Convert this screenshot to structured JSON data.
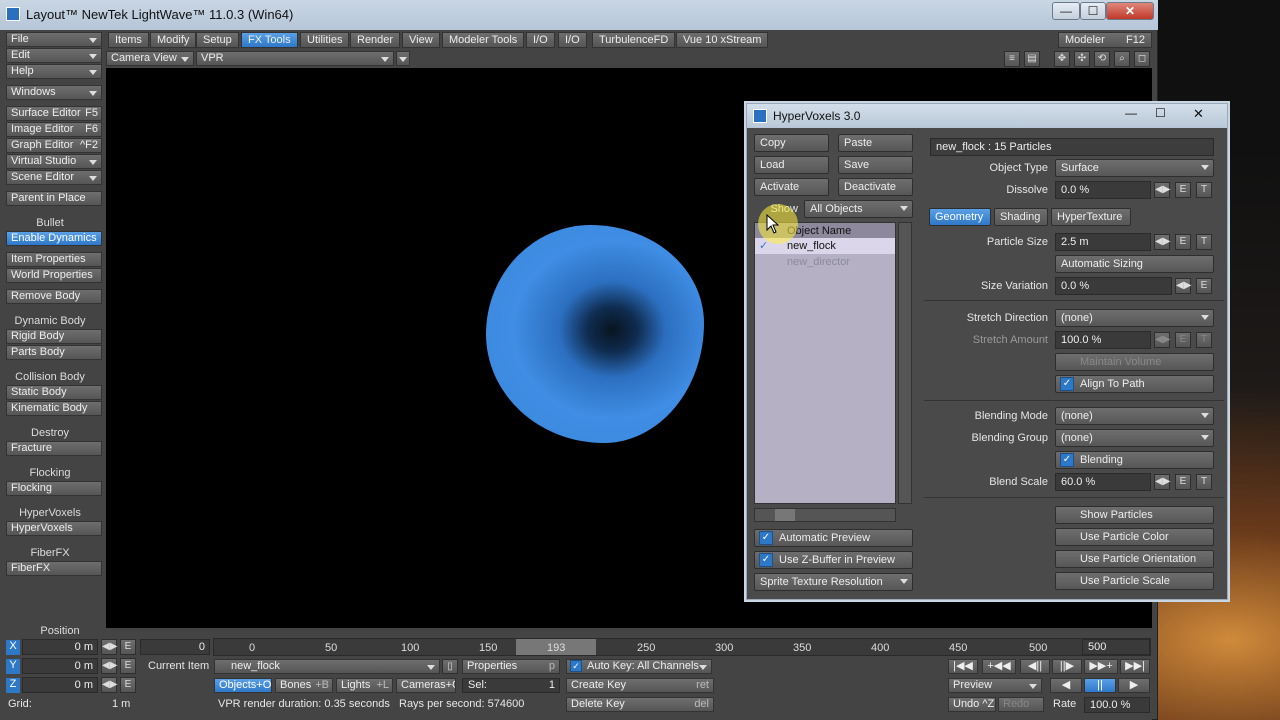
{
  "window": {
    "title": "Layout™ NewTek LightWave™ 11.0.3 (Win64)",
    "minimize": "—",
    "maximize": "☐",
    "close": "✕"
  },
  "left_menus": [
    {
      "label": "File"
    },
    {
      "label": "Edit"
    },
    {
      "label": "Help"
    },
    {
      "label": "Windows"
    }
  ],
  "left_tools": {
    "surface_editor": "Surface Editor",
    "surface_editor_key": "F5",
    "image_editor": "Image Editor",
    "image_editor_key": "F6",
    "graph_editor": "Graph Editor",
    "graph_editor_key": "^F2",
    "virtual_studio": "Virtual Studio",
    "scene_editor": "Scene Editor",
    "parent_in_place": "Parent in Place",
    "bullet": "Bullet",
    "enable_dynamics": "Enable Dynamics",
    "item_properties": "Item Properties",
    "world_properties": "World Properties",
    "remove_body": "Remove Body",
    "dynamic_body_h": "Dynamic Body",
    "rigid_body": "Rigid Body",
    "parts_body": "Parts Body",
    "collision_body_h": "Collision Body",
    "static_body": "Static Body",
    "kinematic_body": "Kinematic Body",
    "destroy_h": "Destroy",
    "fracture": "Fracture",
    "flocking_h": "Flocking",
    "flocking": "Flocking",
    "hypervoxels_h": "HyperVoxels",
    "hypervoxels": "HyperVoxels",
    "fiberfx_h": "FiberFX",
    "fiberfx": "FiberFX"
  },
  "menu_tabs": [
    "Items",
    "Modify",
    "Setup",
    "FX Tools",
    "Utilities",
    "Render",
    "View",
    "Modeler Tools",
    "I/O",
    "I/O",
    "TurbulenceFD",
    "Vue 10 xStream"
  ],
  "modeler": {
    "label": "Modeler",
    "key": "F12"
  },
  "viewport": {
    "view": "Camera View",
    "mode": "VPR"
  },
  "hv": {
    "title": "HyperVoxels 3.0",
    "copy": "Copy",
    "paste": "Paste",
    "load": "Load",
    "save": "Save",
    "activate": "Activate",
    "deactivate": "Deactivate",
    "show": "Show",
    "show_filter": "All Objects",
    "col_header": "Object Name",
    "objects": [
      {
        "name": "new_flock",
        "check": "✓"
      },
      {
        "name": "new_director",
        "check": ""
      }
    ],
    "auto_preview": "Automatic Preview",
    "zbuffer": "Use Z-Buffer in Preview",
    "sprite": "Sprite Texture Resolution",
    "info": "new_flock : 15 Particles",
    "object_type_l": "Object Type",
    "object_type": "Surface",
    "dissolve_l": "Dissolve",
    "dissolve": "0.0 %",
    "tabs": [
      "Geometry",
      "Shading",
      "HyperTexture"
    ],
    "particle_size_l": "Particle Size",
    "particle_size": "2.5 m",
    "auto_sizing": "Automatic Sizing",
    "size_var_l": "Size Variation",
    "size_var": "0.0 %",
    "stretch_dir_l": "Stretch Direction",
    "stretch_dir": "(none)",
    "stretch_amt_l": "Stretch Amount",
    "stretch_amt": "100.0 %",
    "maintain_volume": "Maintain Volume",
    "align_path": "Align To Path",
    "blend_mode_l": "Blending Mode",
    "blend_mode": "(none)",
    "blend_group_l": "Blending Group",
    "blend_group": "(none)",
    "blending": "Blending",
    "blend_scale_l": "Blend Scale",
    "blend_scale": "60.0 %",
    "show_particles": "Show Particles",
    "use_color": "Use Particle Color",
    "use_orient": "Use Particle Orientation",
    "use_scale": "Use Particle Scale",
    "e": "E",
    "t": "T",
    "arrows": "◀▶"
  },
  "bottom": {
    "position": "Position",
    "x": "X",
    "y": "Y",
    "z": "Z",
    "xv": "0 m",
    "yv": "0 m",
    "zv": "0 m",
    "e": "E",
    "frame_start": "0",
    "grid_l": "Grid:",
    "grid": "1 m",
    "ticks": [
      "0",
      "50",
      "100",
      "150",
      "193",
      "250",
      "300",
      "350",
      "400",
      "450",
      "500"
    ],
    "frame_end": "500",
    "current_item_l": "Current Item",
    "current_item": "new_flock",
    "properties": "Properties",
    "properties_key": "p",
    "auto_key": "Auto Key: All Channels",
    "objects": "Objects+O",
    "bones": "Bones",
    "bones_key": "+B",
    "lights": "Lights",
    "lights_key": "+L",
    "cameras": "Cameras+C",
    "sel_l": "Sel:",
    "sel": "1",
    "create_key": "Create Key",
    "create_key_k": "ret",
    "delete_key": "Delete Key",
    "delete_key_k": "del",
    "vpr_status": "VPR render duration: 0.35 seconds   Rays per second: 574600",
    "preview": "Preview",
    "undo": "Undo ^Z",
    "redo": "Redo",
    "rate_l": "Rate",
    "rate": "100.0 %",
    "transport": [
      "|◀◀",
      "+◀◀",
      "◀||",
      "||▶",
      "▶▶+",
      "▶▶|"
    ],
    "play": [
      "◀",
      "||",
      "▶"
    ]
  }
}
